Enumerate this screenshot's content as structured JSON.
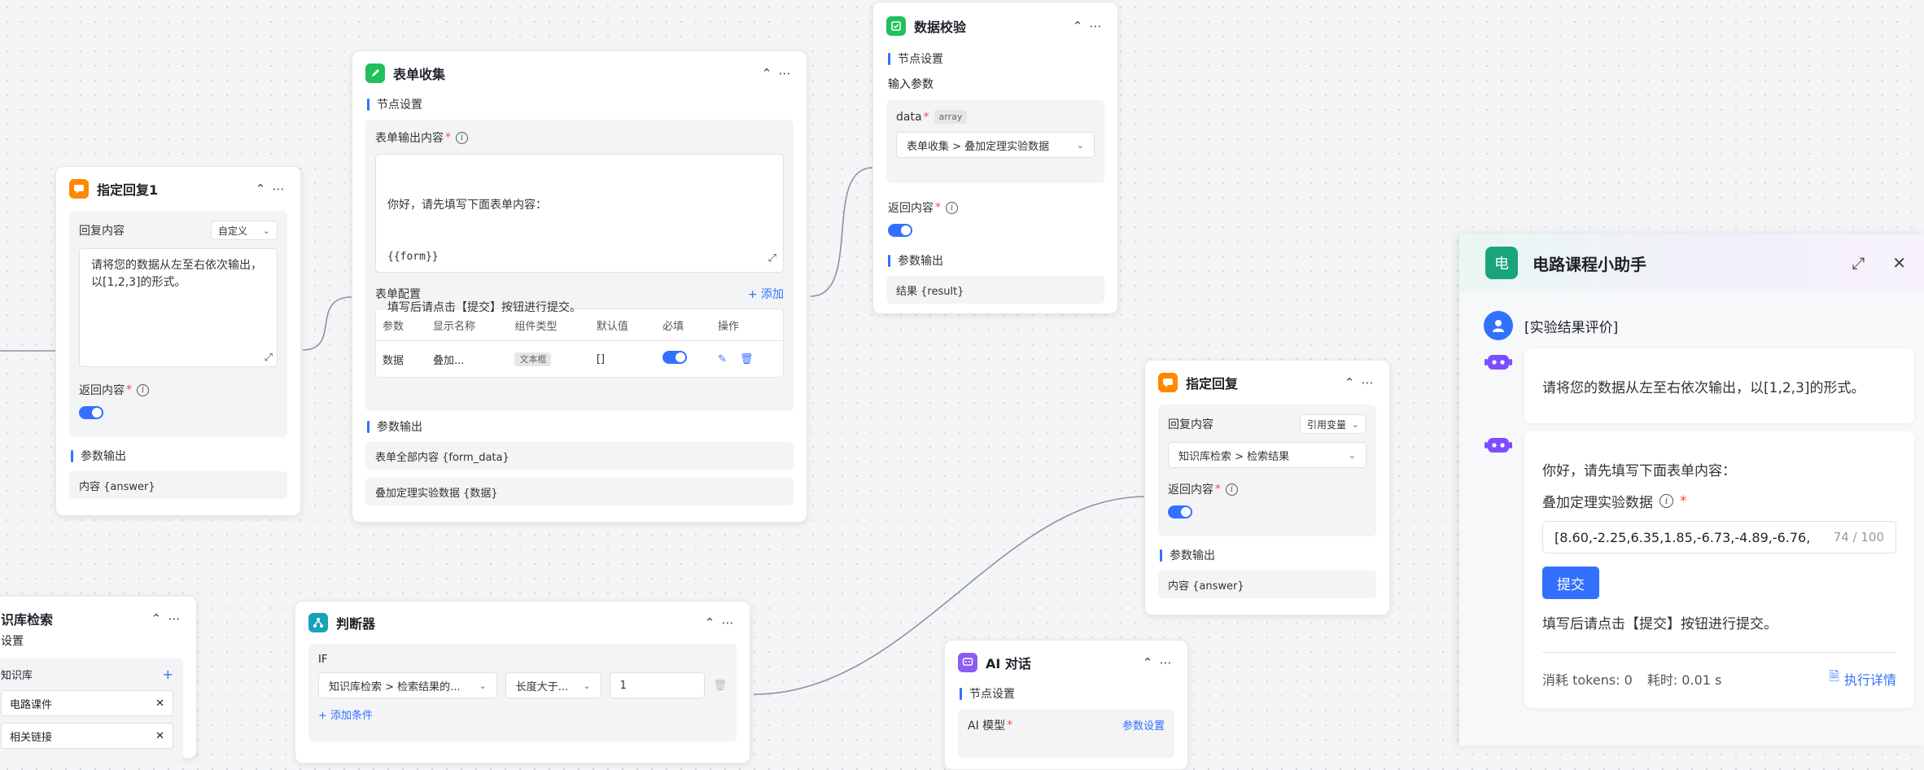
{
  "colors": {
    "accent": "#3370ff",
    "orange": "#ff8800",
    "green": "#20c05c",
    "teal": "#17a2b8",
    "purple": "#8b5cf6",
    "chat_logo": "#18a57a"
  },
  "reply1": {
    "title": "指定回复1",
    "content_label": "回复内容",
    "mode": "自定义",
    "text": "请将您的数据从左至右依次输出，\n以[1,2,3]的形式。",
    "return_label": "返回内容",
    "output_label": "参数输出",
    "output_item": "内容 {answer}"
  },
  "form": {
    "title": "表单收集",
    "settings": "节点设置",
    "output_label": "表单输出内容",
    "textarea_lines": [
      "你好，请先填写下面表单内容：",
      "{{form}}",
      "填写后请点击【提交】按钮进行提交。"
    ],
    "config_label": "表单配置",
    "add": "+ 添加",
    "columns": [
      "参数",
      "显示名称",
      "组件类型",
      "默认值",
      "必填",
      "操作"
    ],
    "row": {
      "param": "数据",
      "display": "叠加...",
      "type": "文本框",
      "default": "[]"
    },
    "output_section": "参数输出",
    "outputs": [
      "表单全部内容 {form_data}",
      "叠加定理实验数据 {数据}"
    ]
  },
  "validate": {
    "title": "数据校验",
    "settings": "节点设置",
    "input_label": "输入参数",
    "data_label": "data",
    "data_type": "array",
    "source": "表单收集 > 叠加定理实验数据",
    "return_label": "返回内容",
    "output_section": "参数输出",
    "output_item": "结果 {result}"
  },
  "reply2": {
    "title": "指定回复",
    "content_label": "回复内容",
    "mode": "引用变量",
    "source": "知识库检索 > 检索结果",
    "return_label": "返回内容",
    "output_section": "参数输出",
    "output_item": "内容 {answer}"
  },
  "kb": {
    "title": "识库检索",
    "settings": "设置",
    "kb_label": "知识库",
    "items": [
      "电路课件",
      "相关链接"
    ]
  },
  "judge": {
    "title": "判断器",
    "if_label": "IF",
    "var": "知识库检索 > 检索结果的...",
    "op": "长度大于...",
    "value": "1",
    "add": "+ 添加条件"
  },
  "ai": {
    "title": "AI 对话",
    "settings": "节点设置",
    "model_label": "AI 模型",
    "param_link": "参数设置"
  },
  "chat": {
    "logo": "电",
    "title": "电路课程小助手",
    "user_msg": "[实验结果评价]",
    "bot1": "请将您的数据从左至右依次输出，以[1,2,3]的形式。",
    "bot2_intro": "你好，请先填写下面表单内容：",
    "field_label": "叠加定理实验数据",
    "field_value": "[8.60,-2.25,6.35,1.85,-6.73,-4.89,-6.76,",
    "field_count": "74 / 100",
    "submit": "提交",
    "after": "填写后请点击【提交】按钮进行提交。",
    "tokens": "消耗 tokens: 0",
    "time": "耗时: 0.01 s",
    "detail": "执行详情"
  }
}
